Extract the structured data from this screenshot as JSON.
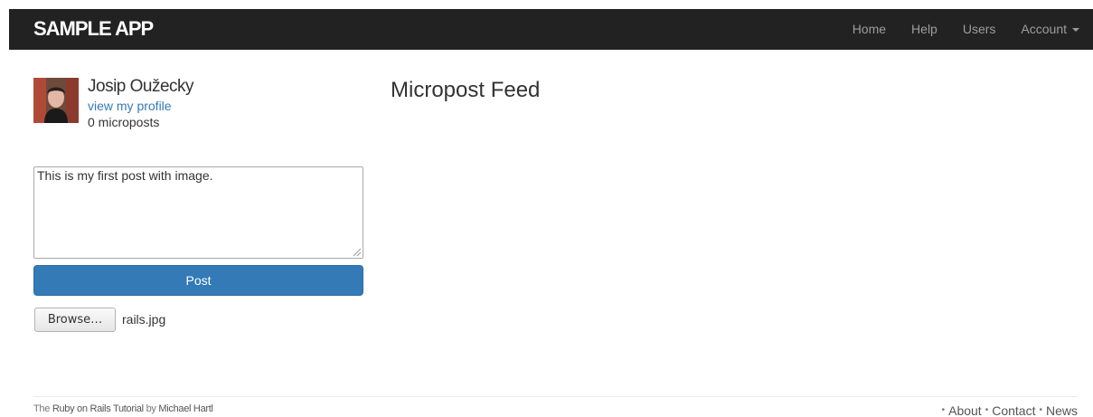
{
  "navbar": {
    "logo": "SAMPLE APP",
    "items": [
      {
        "label": "Home"
      },
      {
        "label": "Help"
      },
      {
        "label": "Users"
      },
      {
        "label": "Account"
      }
    ]
  },
  "user": {
    "name": "Josip Oužecky",
    "profile_link": "view my profile",
    "post_count": "0 microposts"
  },
  "feed": {
    "title": "Micropost Feed"
  },
  "composer": {
    "value": "This is my first post with image.",
    "post_label": "Post",
    "browse_label": "Browse…",
    "file_name": "rails.jpg"
  },
  "footer": {
    "text_the": "The ",
    "link_tutorial": "Ruby on Rails Tutorial",
    "text_by": " by ",
    "link_author": "Michael Hartl",
    "links": [
      "About",
      "Contact",
      "News"
    ],
    "bullet": "•"
  },
  "colors": {
    "navbar_bg": "#222222",
    "primary": "#337ab7",
    "link": "#337ab7"
  }
}
